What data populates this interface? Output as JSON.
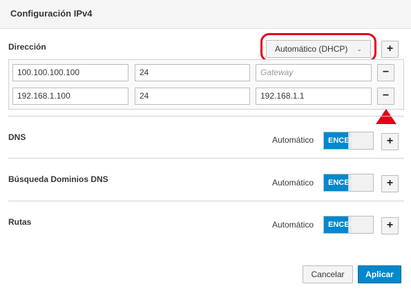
{
  "dialog": {
    "title": "Configuración IPv4"
  },
  "address": {
    "label": "Dirección",
    "method": "Automático (DHCP)",
    "add_label": "+",
    "rows": [
      {
        "address": "100.100.100.100",
        "prefix": "24",
        "gateway": "",
        "gateway_placeholder": "Gateway",
        "remove_label": "−"
      },
      {
        "address": "192.168.1.100",
        "prefix": "24",
        "gateway": "192.168.1.1",
        "gateway_placeholder": "",
        "remove_label": "−"
      }
    ]
  },
  "dns": {
    "label": "DNS",
    "auto_label": "Automático",
    "toggle_label": "ENCENDIDO",
    "add_label": "+"
  },
  "dns_search": {
    "label": "Búsqueda Dominios DNS",
    "auto_label": "Automático",
    "toggle_label": "ENCENDIDO",
    "add_label": "+"
  },
  "routes": {
    "label": "Rutas",
    "auto_label": "Automático",
    "toggle_label": "ENCENDIDO",
    "add_label": "+"
  },
  "footer": {
    "cancel_label": "Cancelar",
    "apply_label": "Aplicar"
  },
  "colors": {
    "accent": "#0088ce",
    "annotation": "#e3001b"
  }
}
